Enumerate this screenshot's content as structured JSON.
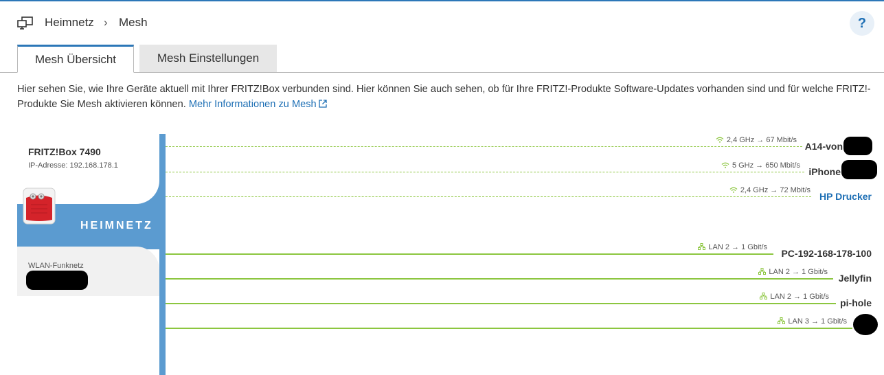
{
  "breadcrumb": {
    "root": "Heimnetz",
    "current": "Mesh"
  },
  "help": {
    "label": "?"
  },
  "tabs": [
    {
      "label": "Mesh Übersicht",
      "active": true
    },
    {
      "label": "Mesh Einstellungen",
      "active": false
    }
  ],
  "description": {
    "text": "Hier sehen Sie, wie Ihre Geräte aktuell mit Ihrer FRITZ!Box verbunden sind. Hier können Sie auch sehen, ob für Ihre FRITZ!-Produkte Software-Updates vorhanden sind und für welche FRITZ!-Produkte Sie Mesh aktivieren können.",
    "link": "Mehr Informationen zu Mesh"
  },
  "router": {
    "name": "FRITZ!Box 7490",
    "ip": "IP-Adresse: 192.168.178.1"
  },
  "network": {
    "label": "HEIMNETZ",
    "wlan_label": "WLAN-Funknetz"
  },
  "connections": [
    {
      "type": "wlan",
      "meta": "2,4 GHz → 67 Mbit/s",
      "device": "A14-von"
    },
    {
      "type": "wlan",
      "meta": "5 GHz → 650 Mbit/s",
      "device": "iPhone"
    },
    {
      "type": "wlan",
      "meta": "2,4 GHz → 72 Mbit/s",
      "device": "HP Drucker"
    },
    {
      "type": "lan",
      "meta": "LAN 2 → 1 Gbit/s",
      "device": "PC-192-168-178-100"
    },
    {
      "type": "lan",
      "meta": "LAN 2 → 1 Gbit/s",
      "device": "Jellyfin"
    },
    {
      "type": "lan",
      "meta": "LAN 2 → 1 Gbit/s",
      "device": "pi-hole"
    },
    {
      "type": "lan",
      "meta": "LAN 3 → 1 Gbit/s",
      "device": ""
    }
  ],
  "colors": {
    "accent": "#2c77b8",
    "band": "#5b9bd0",
    "line": "#8cc63f",
    "link": "#1c6eb4"
  }
}
